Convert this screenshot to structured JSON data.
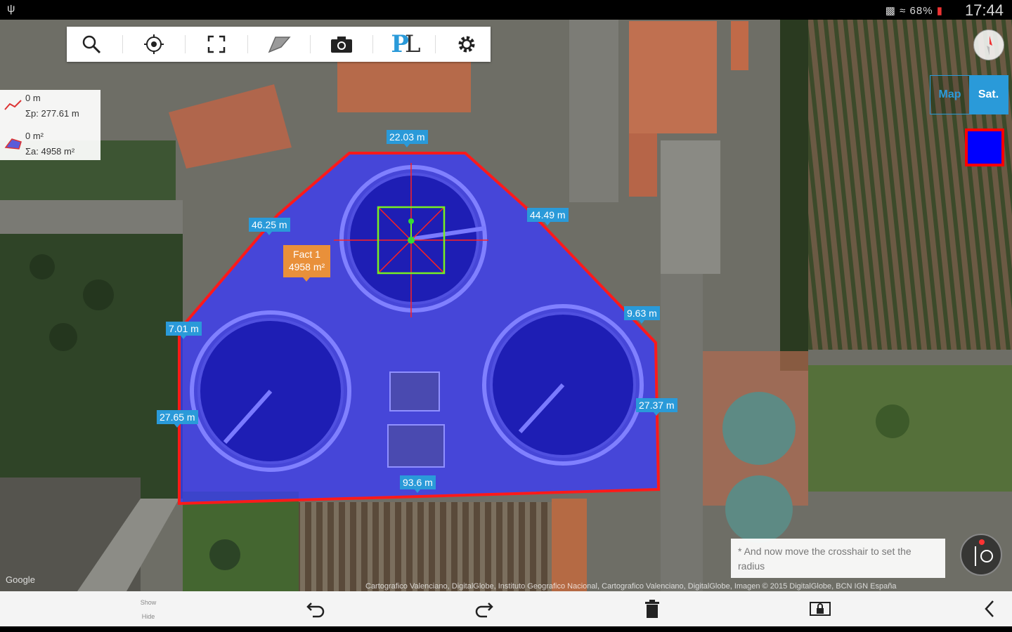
{
  "status_bar": {
    "usb_icon": "usb-icon",
    "icons_text": "≡≠ ≈ 68%",
    "battery_percent": "68%",
    "time": "17:44"
  },
  "toolbar": {
    "tools": [
      "search-icon",
      "locate-icon",
      "fullscreen-icon",
      "shape-icon",
      "camera-icon",
      "planimeter-logo",
      "gear-icon"
    ],
    "logo_text": "PL"
  },
  "info_panel": {
    "distance": "0 m",
    "perimeter": "Σp: 277.61 m",
    "area": "0 m²",
    "total_area": "Σa: 4958 m²"
  },
  "measurements": {
    "top": "22.03 m",
    "upper_left": "46.25 m",
    "upper_right": "44.49 m",
    "right_corner": "9.63 m",
    "left_corner": "7.01 m",
    "left": "27.65 m",
    "right": "27.37 m",
    "bottom": "93.6 m"
  },
  "fact_label": {
    "line1": "Fact 1",
    "line2": "4958 m²"
  },
  "map_toggle": {
    "map_label": "Map",
    "sat_label": "Sat.",
    "selected": "Sat."
  },
  "colors": {
    "polygon_fill": "#3a3aff",
    "polygon_stroke": "#ff1a1a",
    "accent": "#2a9ad9",
    "swatch": "#0000ff"
  },
  "hint": {
    "text": "* And now move the crosshair to set the radius"
  },
  "attribution": {
    "text": "Cartografico Valenciano, DigitalGlobe, Instituto Geografico Nacional, Cartografico Valenciano, DigitalGlobe, Imagen © 2015 DigitalGlobe, BCN IGN España",
    "google": "Google"
  },
  "bottom_bar": {
    "show_label": "Show",
    "hide_label": "Hide",
    "buttons": [
      "undo-icon",
      "redo-icon",
      "trash-icon",
      "lock-screen-icon",
      "chevron-left-icon"
    ]
  }
}
